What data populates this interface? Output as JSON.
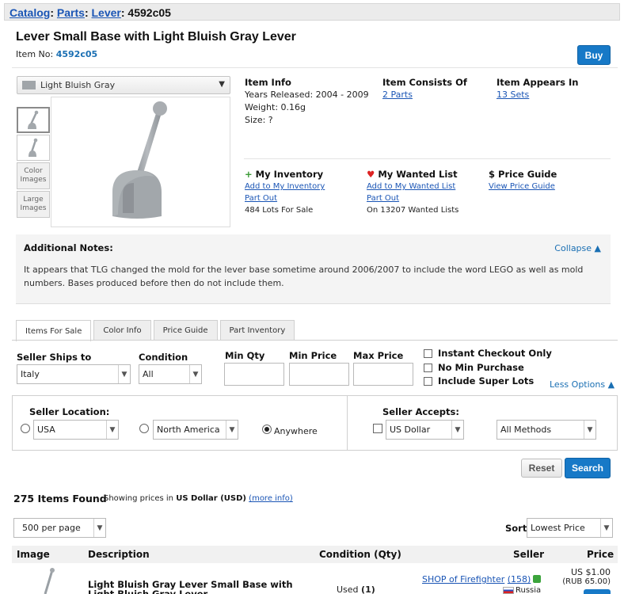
{
  "breadcrumb": {
    "items": [
      "Catalog",
      "Parts",
      "Lever"
    ],
    "current": "4592c05"
  },
  "item": {
    "title": "Lever Small Base with Light Bluish Gray Lever",
    "item_no_label": "Item No:",
    "item_no": "4592c05",
    "buy_label": "Buy"
  },
  "color_select": {
    "value": "Light Bluish Gray",
    "swatch_color": "#a0a5a9"
  },
  "thumbs": {
    "color_images": "Color Images",
    "large_images": "Large Images"
  },
  "info": {
    "item_info_title": "Item Info",
    "years_released": "Years Released: 2004 - 2009",
    "weight": "Weight: 0.16g",
    "size": "Size: ?",
    "consists_title": "Item Consists Of",
    "consists_link": "2 Parts",
    "appears_title": "Item Appears In",
    "appears_link": "13 Sets",
    "inventory_title": "My Inventory",
    "inventory_add": "Add to My Inventory",
    "inventory_partout": "Part Out",
    "inventory_lots": "484 Lots For Sale",
    "wanted_title": "My Wanted List",
    "wanted_add": "Add to My Wanted List",
    "wanted_partout": "Part Out",
    "wanted_count": "On 13207 Wanted Lists",
    "price_title": "Price Guide",
    "price_link": "View Price Guide"
  },
  "notes": {
    "title": "Additional Notes:",
    "collapse": "Collapse ▲",
    "body": "It appears that TLG changed the mold for the lever base sometime around 2006/2007 to include the word LEGO as well as mold numbers. Bases produced before then do not include them."
  },
  "tabs": [
    "Items For Sale",
    "Color Info",
    "Price Guide",
    "Part Inventory"
  ],
  "filters": {
    "ships_label": "Seller Ships to",
    "ships_value": "Italy",
    "condition_label": "Condition",
    "condition_value": "All",
    "min_qty_label": "Min Qty",
    "min_price_label": "Min Price",
    "max_price_label": "Max Price",
    "instant_checkout": "Instant Checkout Only",
    "no_min_purchase": "No Min Purchase",
    "include_super_lots": "Include Super Lots",
    "less_options": "Less Options ▲",
    "location_label": "Seller Location:",
    "location_country": "USA",
    "location_region": "North America",
    "location_anywhere": "Anywhere",
    "accepts_label": "Seller Accepts:",
    "currency": "US Dollar",
    "methods": "All Methods",
    "reset": "Reset",
    "search": "Search"
  },
  "results": {
    "count": "275 Items Found",
    "showing_prefix": "Showing prices in",
    "currency": "US Dollar (USD)",
    "more_info": "(more info)",
    "per_page": "500 per page",
    "sort_label": "Sort",
    "sort_value": "Lowest Price"
  },
  "table": {
    "headers": [
      "Image",
      "Description",
      "Condition (Qty)",
      "Seller",
      "Price"
    ],
    "rows": [
      {
        "description": "Light Bluish Gray Lever Small Base with Light Bluish Gray Lever",
        "condition": "Used",
        "qty": "(1)",
        "seller": "SHOP of Firefighter",
        "feedback": "(158)",
        "country": "Russia",
        "price": "US $1.00",
        "price_local": "(RUB 65.00)"
      }
    ]
  }
}
